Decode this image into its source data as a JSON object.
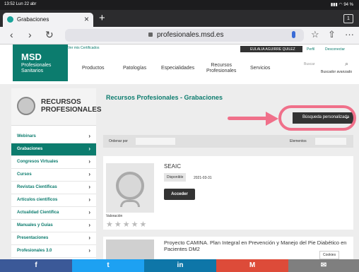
{
  "status_bar": {
    "time": "13:52 Lun 22 abr",
    "battery": "94 %"
  },
  "browser": {
    "tab_title": "Grabaciones",
    "url": "profesionales.msd.es",
    "tab_count": "1"
  },
  "header": {
    "logo_title": "MSD",
    "logo_subtitle_1": "Profesionales",
    "logo_subtitle_2": "Sanitarios",
    "certs_link": "Ver mis Certificados",
    "user_name": "EULALIA AGUIRRE QUILEZ",
    "profile_link": "Perfil",
    "logout_link": "Desconectar",
    "nav": [
      "Productos",
      "Patologías",
      "Especialidades",
      "Recursos",
      "Profesionales",
      "Servicios"
    ],
    "search_placeholder": "Buscar",
    "advanced_search": "Buscador avanzado"
  },
  "sidebar": {
    "title_1": "RECURSOS",
    "title_2": "PROFESIONALES",
    "items": [
      {
        "label": "Webinars"
      },
      {
        "label": "Grabaciones"
      },
      {
        "label": "Congresos Virtuales"
      },
      {
        "label": "Cursos"
      },
      {
        "label": "Revistas Científicas"
      },
      {
        "label": "Artículos científicos"
      },
      {
        "label": "Actualidad Científica"
      },
      {
        "label": "Manuales y Guías"
      },
      {
        "label": "Presentaciones"
      },
      {
        "label": "Profesionales 3.0"
      }
    ]
  },
  "main": {
    "page_title": "Recursos Profesionales - Grabaciones",
    "advanced_search_button": "Búsqueda personalizada",
    "sort_label": "Ordenar por",
    "elements_label": "Elementos",
    "card": {
      "title": "SEAIC",
      "badge": "Disponible",
      "date": "2021-03-31",
      "action": "Acceder",
      "rating_label": "Valoración",
      "rating": "★★★★★"
    },
    "card2_title": "Proyecto CAMINA. Plan Integral en Prevención y Manejo del Pie Diabético en Pacientes DM2",
    "cookies": "Cookies"
  },
  "share": {
    "facebook": "f",
    "twitter": "t",
    "linkedin": "in",
    "gmail": "M",
    "email": "✉",
    "colors": [
      "#3b5998",
      "#1da1f2",
      "#0e76a8",
      "#dd4b39",
      "#7f7f7f"
    ]
  }
}
